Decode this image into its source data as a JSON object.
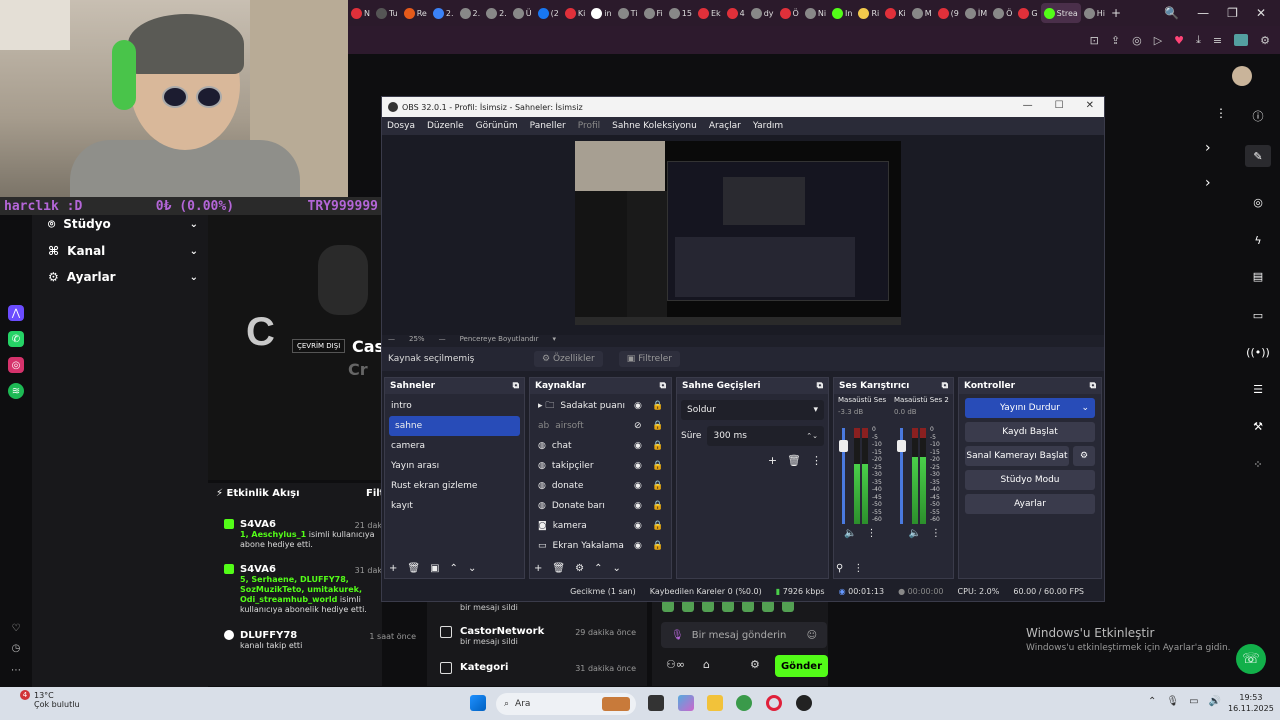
{
  "browser": {
    "tabs": [
      {
        "label": "N",
        "color": "#e0303a"
      },
      {
        "label": "Tu",
        "color": "#555"
      },
      {
        "label": "Re",
        "color": "#e55a1a"
      },
      {
        "label": "2.",
        "color": "#3b82f6"
      },
      {
        "label": "2.",
        "color": "#888"
      },
      {
        "label": "2.",
        "color": "#888"
      },
      {
        "label": "Ü",
        "color": "#888"
      },
      {
        "label": "(2",
        "color": "#1877f2"
      },
      {
        "label": "Ki",
        "color": "#e0303a"
      },
      {
        "label": "in",
        "color": "#fff"
      },
      {
        "label": "Ti",
        "color": "#888"
      },
      {
        "label": "Fi",
        "color": "#888"
      },
      {
        "label": "15",
        "color": "#888"
      },
      {
        "label": "Ek",
        "color": "#e0303a"
      },
      {
        "label": "4",
        "color": "#e0303a"
      },
      {
        "label": "dy",
        "color": "#888"
      },
      {
        "label": "Ö",
        "color": "#e0303a"
      },
      {
        "label": "Ni",
        "color": "#888"
      },
      {
        "label": "In",
        "color": "#53fc18"
      },
      {
        "label": "Ri",
        "color": "#f2c94c"
      },
      {
        "label": "Ki",
        "color": "#e0303a"
      },
      {
        "label": "M",
        "color": "#888"
      },
      {
        "label": "(9",
        "color": "#e0303a"
      },
      {
        "label": "İM",
        "color": "#888"
      },
      {
        "label": "Ö",
        "color": "#888"
      },
      {
        "label": "G",
        "color": "#e0303a"
      },
      {
        "label": "Strea",
        "color": "#53fc18",
        "active": true
      },
      {
        "label": "Hi",
        "color": "#888"
      }
    ],
    "new_tab": "+",
    "window_controls": [
      "🔍",
      "—",
      "❐",
      "✕"
    ]
  },
  "overlay": {
    "donate_left": "harclık :D",
    "donate_mid": "0₺ (0.00%)",
    "donate_right": "TRY999999"
  },
  "left_nav": {
    "items": [
      {
        "label": "Stüdyo",
        "icon": "studio-icon"
      },
      {
        "label": "Kanal",
        "icon": "channel-icon"
      },
      {
        "label": "Ayarlar",
        "icon": "gear-icon"
      }
    ]
  },
  "stream": {
    "big_letter": "C",
    "offline_badge": "ÇEVRİM DIŞI",
    "channel_partial": "Cas",
    "channel_partial2": "Cr"
  },
  "activity": {
    "title": "Etkinlik Akışı",
    "filter": "Filt",
    "items": [
      {
        "user": "S4VA6",
        "time": "21 dak",
        "msg_bold": "1, Aeschylus_1",
        "msg": " isimli kullanıcıya abone hediye etti."
      },
      {
        "user": "S4VA6",
        "time": "31 dak",
        "msg_bold": "5, Serhaene, DLUFFY78, SozMuzikTeto, umitakurek, Odi_streamhub_world",
        "msg": " isimli kullanıcıya abonelik hediye etti."
      },
      {
        "user": "DLUFFY78",
        "time": "1 saat önce",
        "msg_bold": "",
        "msg": "kanalı takip etti"
      }
    ]
  },
  "mid_lower": {
    "items": [
      {
        "user": "",
        "msg": "bir mesajı sildi",
        "time": ""
      },
      {
        "user": "CastorNetwork",
        "msg": "bir mesajı sildi",
        "time": "29 dakika önce"
      },
      {
        "user": "Kategori",
        "msg": "",
        "time": "31 dakika önce"
      }
    ]
  },
  "chat": {
    "placeholder": "Bir mesaj gönderin",
    "send": "Gönder"
  },
  "windows": {
    "activate_title": "Windows'u Etkinleştir",
    "activate_sub": "Windows'u etkinleştirmek için Ayarlar'a gidin."
  },
  "obs": {
    "title": "OBS 32.0.1 - Profil: İsimsiz - Sahneler: İsimsiz",
    "menu": [
      "Dosya",
      "Düzenle",
      "Görünüm",
      "Paneller",
      "Profil",
      "Sahne Koleksiyonu",
      "Araçlar",
      "Yardım"
    ],
    "zoom": "25%",
    "zoom_mode": "Pencereye Boyutlandır",
    "no_source": "Kaynak seçilmemiş",
    "properties": "Özellikler",
    "filters": "Filtreler",
    "scenes_title": "Sahneler",
    "scenes": [
      "intro",
      "sahne",
      "camera",
      "Yayın arası",
      "Rust ekran gizleme",
      "kayıt"
    ],
    "selected_scene": 1,
    "sources_title": "Kaynaklar",
    "sources": [
      {
        "name": "Sadakat puanı",
        "icon": "folder-icon",
        "hidden": false
      },
      {
        "name": "airsoft",
        "icon": "text-icon",
        "hidden": true
      },
      {
        "name": "chat",
        "icon": "browser-icon",
        "hidden": false
      },
      {
        "name": "takipçiler",
        "icon": "browser-icon",
        "hidden": false
      },
      {
        "name": "donate",
        "icon": "browser-icon",
        "hidden": false
      },
      {
        "name": "Donate barı",
        "icon": "browser-icon",
        "hidden": false
      },
      {
        "name": "kamera",
        "icon": "camera-icon",
        "hidden": false
      },
      {
        "name": "Ekran Yakalama",
        "icon": "monitor-icon",
        "hidden": false
      }
    ],
    "transitions_title": "Sahne Geçişleri",
    "transition": "Soldur",
    "duration_label": "Süre",
    "duration": "300 ms",
    "mixer_title": "Ses Karıştırıcı",
    "channels": [
      {
        "name": "Masaüstü Ses",
        "db": "-3.3 dB",
        "level": 0.62
      },
      {
        "name": "Masaüstü Ses 2",
        "db": "0.0 dB",
        "level": 0.7
      }
    ],
    "meter_ticks": [
      "0",
      "-5",
      "-10",
      "-15",
      "-20",
      "-25",
      "-30",
      "-35",
      "-40",
      "-45",
      "-50",
      "-55",
      "-60"
    ],
    "controls_title": "Kontroller",
    "controls": [
      "Yayını Durdur",
      "Kaydı Başlat",
      "Sanal Kamerayı Başlat",
      "Stüdyo Modu",
      "Ayarlar"
    ],
    "status": {
      "delay": "Gecikme (1 san)",
      "dropped": "Kaybedilen Kareler 0 (%0.0)",
      "bitrate": "7926 kbps",
      "stream_time": "00:01:13",
      "rec_time": "00:00:00",
      "cpu": "CPU: 2.0%",
      "fps": "60.00 / 60.00 FPS"
    }
  },
  "taskbar": {
    "weather_temp": "13°C",
    "weather_desc": "Çok bulutlu",
    "search": "Ara",
    "time": "19:53",
    "date": "16.11.2025",
    "badge": "4"
  }
}
